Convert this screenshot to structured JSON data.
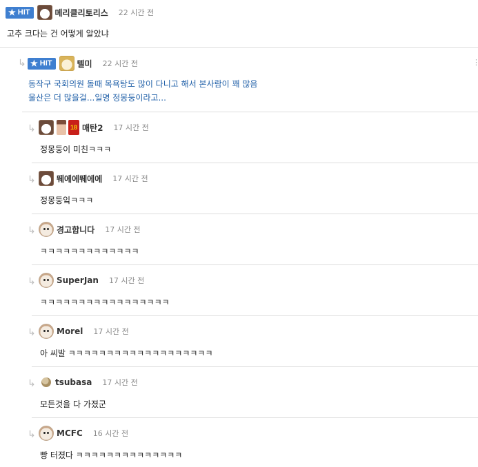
{
  "comments": [
    {
      "nick": "메리클리토리스",
      "time": "22 시간 전",
      "hit": "HIT",
      "text": "고추 크다는 건 어떻게 알았냐"
    },
    {
      "nick": "텔미",
      "time": "22 시간 전",
      "hit": "HIT",
      "lines": [
        "동작구 국회의원 돌때 목욕탕도 많이 다니고 해서 본사람이 꽤 많음",
        "울산은 더 많을걸...일명 정몽둥이라고..."
      ]
    },
    {
      "nick": "매탄2",
      "time": "17 시간 전",
      "text": "정몽둥이 미친ㅋㅋㅋ"
    },
    {
      "nick": "뛔에에뛔에에",
      "time": "17 시간 전",
      "text": "정몽둥잌ㅋㅋㅋ"
    },
    {
      "nick": "경고합니다",
      "time": "17 시간 전",
      "text": "ㅋㅋㅋㅋㅋㅋㅋㅋㅋㅋㅋㅋㅋ"
    },
    {
      "nick": "SuperJan",
      "time": "17 시간 전",
      "text": "ㅋㅋㅋㅋㅋㅋㅋㅋㅋㅋㅋㅋㅋㅋㅋㅋㅋ"
    },
    {
      "nick": "Morel",
      "time": "17 시간 전",
      "text": "아 씨발 ㅋㅋㅋㅋㅋㅋㅋㅋㅋㅋㅋㅋㅋㅋㅋㅋㅋㅋㅋ"
    },
    {
      "nick": "tsubasa",
      "time": "17 시간 전",
      "text": "모든것을 다 가졌군"
    },
    {
      "nick": "MCFC",
      "time": "16 시간 전",
      "text": "빵 터졌다 ㅋㅋㅋㅋㅋㅋㅋㅋㅋㅋㅋㅋㅋㅋ"
    }
  ],
  "icons": {
    "hit": "star-icon",
    "reply": "reply-arrow-icon",
    "more": "more-icon"
  },
  "colors": {
    "hit_badge": "#3f7fd0",
    "link_text": "#1f5fa8",
    "meta_time": "#888888"
  }
}
